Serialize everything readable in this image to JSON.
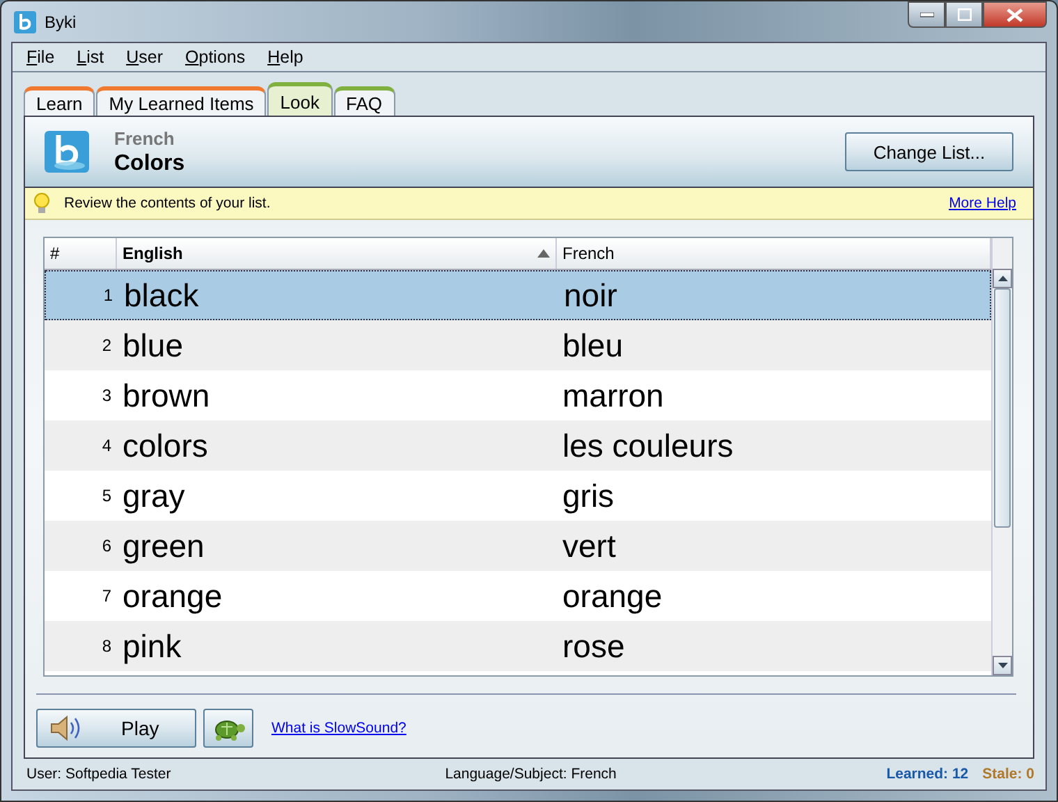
{
  "window": {
    "title": "Byki"
  },
  "menu": [
    {
      "label": "File"
    },
    {
      "label": "List"
    },
    {
      "label": "User"
    },
    {
      "label": "Options"
    },
    {
      "label": "Help"
    }
  ],
  "tabs": [
    {
      "label": "Learn",
      "selected": false,
      "color": "#f07a30"
    },
    {
      "label": "My Learned Items",
      "selected": false,
      "color": "#f07a30"
    },
    {
      "label": "Look",
      "selected": true,
      "color": "#7fb040"
    },
    {
      "label": "FAQ",
      "selected": false,
      "color": "#7fb040"
    }
  ],
  "header": {
    "language": "French",
    "list": "Colors",
    "button": "Change List..."
  },
  "tip": {
    "text": "Review the contents of your list.",
    "link": "More Help"
  },
  "table": {
    "columns": [
      {
        "label": "#",
        "sorted": false
      },
      {
        "label": "English",
        "sorted": true
      },
      {
        "label": "French",
        "sorted": false
      }
    ],
    "rows": [
      {
        "num": "1",
        "english": "black",
        "french": "noir",
        "selected": true
      },
      {
        "num": "2",
        "english": "blue",
        "french": "bleu",
        "selected": false
      },
      {
        "num": "3",
        "english": "brown",
        "french": "marron",
        "selected": false
      },
      {
        "num": "4",
        "english": "colors",
        "french": "les couleurs",
        "selected": false
      },
      {
        "num": "5",
        "english": "gray",
        "french": "gris",
        "selected": false
      },
      {
        "num": "6",
        "english": "green",
        "french": "vert",
        "selected": false
      },
      {
        "num": "7",
        "english": "orange",
        "french": "orange",
        "selected": false
      },
      {
        "num": "8",
        "english": "pink",
        "french": "rose",
        "selected": false
      }
    ]
  },
  "play_button": "Play",
  "slowsound_link": "What is SlowSound?",
  "status_bar": {
    "user": "User: Softpedia Tester",
    "subject": "Language/Subject: French",
    "learned": "Learned: 12",
    "stale": "Stale: 0"
  }
}
